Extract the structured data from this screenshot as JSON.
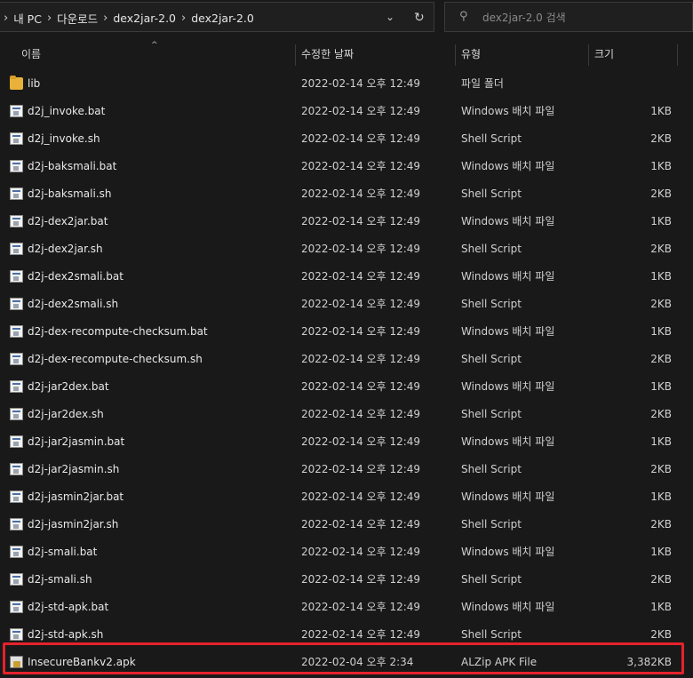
{
  "breadcrumb": [
    "내 PC",
    "다운로드",
    "dex2jar-2.0",
    "dex2jar-2.0"
  ],
  "search": {
    "placeholder": "dex2jar-2.0 검색"
  },
  "columns": {
    "name": "이름",
    "date": "수정한 날짜",
    "type": "유형",
    "size": "크기"
  },
  "files": [
    {
      "name": "lib",
      "date": "2022-02-14 오후 12:49",
      "type": "파일 폴더",
      "size": "",
      "icon": "folder-icon"
    },
    {
      "name": "d2j_invoke.bat",
      "date": "2022-02-14 오후 12:49",
      "type": "Windows 배치 파일",
      "size": "1KB",
      "icon": "batch-file-icon"
    },
    {
      "name": "d2j_invoke.sh",
      "date": "2022-02-14 오후 12:49",
      "type": "Shell Script",
      "size": "2KB",
      "icon": "shell-script-icon"
    },
    {
      "name": "d2j-baksmali.bat",
      "date": "2022-02-14 오후 12:49",
      "type": "Windows 배치 파일",
      "size": "1KB",
      "icon": "batch-file-icon"
    },
    {
      "name": "d2j-baksmali.sh",
      "date": "2022-02-14 오후 12:49",
      "type": "Shell Script",
      "size": "2KB",
      "icon": "shell-script-icon"
    },
    {
      "name": "d2j-dex2jar.bat",
      "date": "2022-02-14 오후 12:49",
      "type": "Windows 배치 파일",
      "size": "1KB",
      "icon": "batch-file-icon"
    },
    {
      "name": "d2j-dex2jar.sh",
      "date": "2022-02-14 오후 12:49",
      "type": "Shell Script",
      "size": "2KB",
      "icon": "shell-script-icon"
    },
    {
      "name": "d2j-dex2smali.bat",
      "date": "2022-02-14 오후 12:49",
      "type": "Windows 배치 파일",
      "size": "1KB",
      "icon": "batch-file-icon"
    },
    {
      "name": "d2j-dex2smali.sh",
      "date": "2022-02-14 오후 12:49",
      "type": "Shell Script",
      "size": "2KB",
      "icon": "shell-script-icon"
    },
    {
      "name": "d2j-dex-recompute-checksum.bat",
      "date": "2022-02-14 오후 12:49",
      "type": "Windows 배치 파일",
      "size": "1KB",
      "icon": "batch-file-icon"
    },
    {
      "name": "d2j-dex-recompute-checksum.sh",
      "date": "2022-02-14 오후 12:49",
      "type": "Shell Script",
      "size": "2KB",
      "icon": "shell-script-icon"
    },
    {
      "name": "d2j-jar2dex.bat",
      "date": "2022-02-14 오후 12:49",
      "type": "Windows 배치 파일",
      "size": "1KB",
      "icon": "batch-file-icon"
    },
    {
      "name": "d2j-jar2dex.sh",
      "date": "2022-02-14 오후 12:49",
      "type": "Shell Script",
      "size": "2KB",
      "icon": "shell-script-icon"
    },
    {
      "name": "d2j-jar2jasmin.bat",
      "date": "2022-02-14 오후 12:49",
      "type": "Windows 배치 파일",
      "size": "1KB",
      "icon": "batch-file-icon"
    },
    {
      "name": "d2j-jar2jasmin.sh",
      "date": "2022-02-14 오후 12:49",
      "type": "Shell Script",
      "size": "2KB",
      "icon": "shell-script-icon"
    },
    {
      "name": "d2j-jasmin2jar.bat",
      "date": "2022-02-14 오후 12:49",
      "type": "Windows 배치 파일",
      "size": "1KB",
      "icon": "batch-file-icon"
    },
    {
      "name": "d2j-jasmin2jar.sh",
      "date": "2022-02-14 오후 12:49",
      "type": "Shell Script",
      "size": "2KB",
      "icon": "shell-script-icon"
    },
    {
      "name": "d2j-smali.bat",
      "date": "2022-02-14 오후 12:49",
      "type": "Windows 배치 파일",
      "size": "1KB",
      "icon": "batch-file-icon"
    },
    {
      "name": "d2j-smali.sh",
      "date": "2022-02-14 오후 12:49",
      "type": "Shell Script",
      "size": "2KB",
      "icon": "shell-script-icon"
    },
    {
      "name": "d2j-std-apk.bat",
      "date": "2022-02-14 오후 12:49",
      "type": "Windows 배치 파일",
      "size": "1KB",
      "icon": "batch-file-icon"
    },
    {
      "name": "d2j-std-apk.sh",
      "date": "2022-02-14 오후 12:49",
      "type": "Shell Script",
      "size": "2KB",
      "icon": "shell-script-icon"
    },
    {
      "name": "InsecureBankv2.apk",
      "date": "2022-02-04 오후 2:34",
      "type": "ALZip APK File",
      "size": "3,382KB",
      "icon": "apk-file-icon"
    }
  ],
  "colors": {
    "background": "#191919",
    "highlight_border": "#e5222b",
    "folder": "#e8b13a"
  }
}
